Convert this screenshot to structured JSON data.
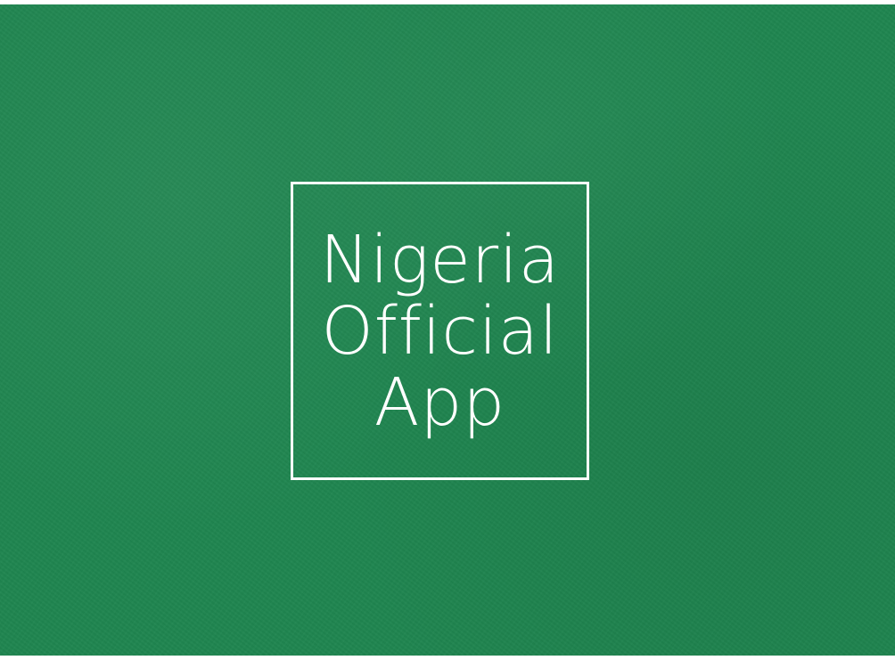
{
  "splash": {
    "background_color": "#1f8650",
    "logo": {
      "border_color": "#ffffff",
      "lines": [
        "Nigeria",
        "Official",
        "App"
      ]
    }
  }
}
